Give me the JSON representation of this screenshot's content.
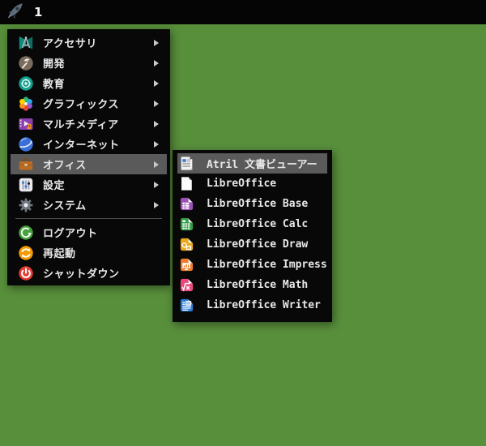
{
  "taskbar": {
    "launcher_icon": "rocket-icon",
    "workspace_label": "1"
  },
  "colors": {
    "desktop_background": "#588f3b",
    "panel_background": "#080808",
    "taskbar_background": "#050505",
    "highlight": "#5a5a5a",
    "menu_text": "#e8e8e8"
  },
  "main_menu": {
    "categories": [
      {
        "id": "accessories",
        "label": "アクセサリ",
        "icon": "accessories-icon",
        "has_submenu": true,
        "highlighted": false
      },
      {
        "id": "development",
        "label": "開発",
        "icon": "development-icon",
        "has_submenu": true,
        "highlighted": false
      },
      {
        "id": "education",
        "label": "教育",
        "icon": "education-icon",
        "has_submenu": true,
        "highlighted": false
      },
      {
        "id": "graphics",
        "label": "グラフィックス",
        "icon": "graphics-icon",
        "has_submenu": true,
        "highlighted": false
      },
      {
        "id": "multimedia",
        "label": "マルチメディア",
        "icon": "multimedia-icon",
        "has_submenu": true,
        "highlighted": false
      },
      {
        "id": "internet",
        "label": "インターネット",
        "icon": "internet-icon",
        "has_submenu": true,
        "highlighted": false
      },
      {
        "id": "office",
        "label": "オフィス",
        "icon": "office-icon",
        "has_submenu": true,
        "highlighted": true
      },
      {
        "id": "settings",
        "label": "設定",
        "icon": "settings-icon",
        "has_submenu": true,
        "highlighted": false
      },
      {
        "id": "system",
        "label": "システム",
        "icon": "system-icon",
        "has_submenu": true,
        "highlighted": false
      }
    ],
    "actions": [
      {
        "id": "logout",
        "label": "ログアウト",
        "icon": "logout-icon"
      },
      {
        "id": "restart",
        "label": "再起動",
        "icon": "restart-icon"
      },
      {
        "id": "shutdown",
        "label": "シャットダウン",
        "icon": "shutdown-icon"
      }
    ]
  },
  "office_submenu": {
    "items": [
      {
        "id": "atril",
        "label": "Atril 文書ビューアー",
        "icon": "atril-icon",
        "highlighted": true
      },
      {
        "id": "libreoffice",
        "label": "LibreOffice",
        "icon": "libreoffice-icon",
        "highlighted": false
      },
      {
        "id": "libreoffice-base",
        "label": "LibreOffice Base",
        "icon": "libreoffice-base-icon",
        "highlighted": false
      },
      {
        "id": "libreoffice-calc",
        "label": "LibreOffice Calc",
        "icon": "libreoffice-calc-icon",
        "highlighted": false
      },
      {
        "id": "libreoffice-draw",
        "label": "LibreOffice Draw",
        "icon": "libreoffice-draw-icon",
        "highlighted": false
      },
      {
        "id": "libreoffice-impress",
        "label": "LibreOffice Impress",
        "icon": "libreoffice-impress-icon",
        "highlighted": false
      },
      {
        "id": "libreoffice-math",
        "label": "LibreOffice Math",
        "icon": "libreoffice-math-icon",
        "highlighted": false
      },
      {
        "id": "libreoffice-writer",
        "label": "LibreOffice Writer",
        "icon": "libreoffice-writer-icon",
        "highlighted": false
      }
    ]
  }
}
